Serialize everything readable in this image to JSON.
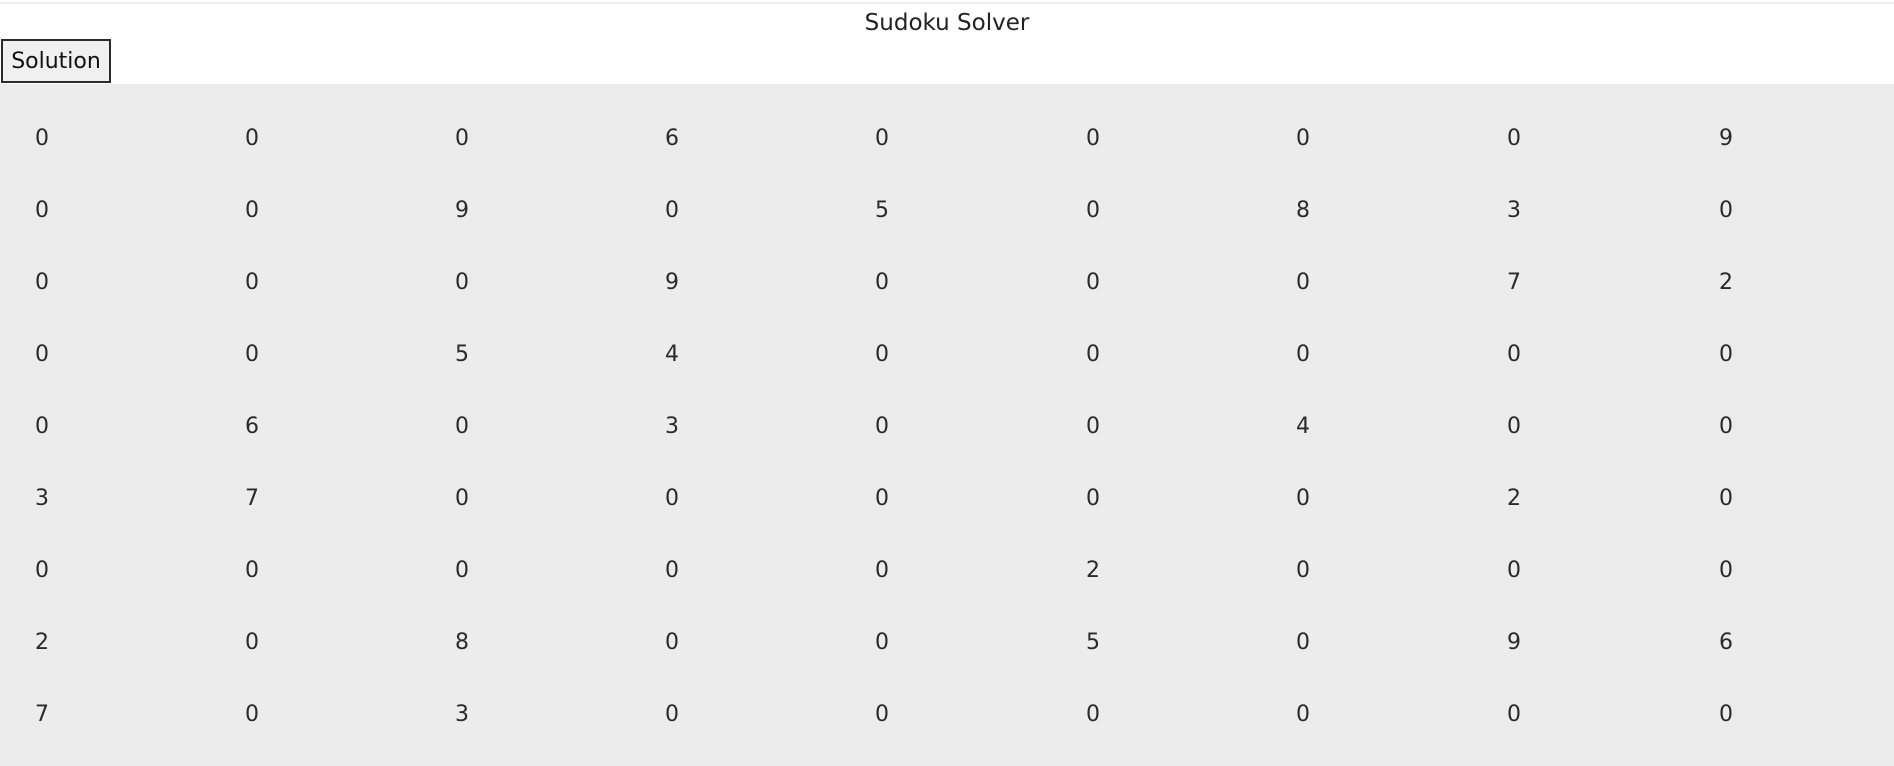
{
  "app": {
    "title": "Sudoku Solver"
  },
  "toolbar": {
    "solution_label": "Solution"
  },
  "board": {
    "rows": [
      [
        "0",
        "0",
        "0",
        "6",
        "0",
        "0",
        "0",
        "0",
        "9"
      ],
      [
        "0",
        "0",
        "9",
        "0",
        "5",
        "0",
        "8",
        "3",
        "0"
      ],
      [
        "0",
        "0",
        "0",
        "9",
        "0",
        "0",
        "0",
        "7",
        "2"
      ],
      [
        "0",
        "0",
        "5",
        "4",
        "0",
        "0",
        "0",
        "0",
        "0"
      ],
      [
        "0",
        "6",
        "0",
        "3",
        "0",
        "0",
        "4",
        "0",
        "0"
      ],
      [
        "3",
        "7",
        "0",
        "0",
        "0",
        "0",
        "0",
        "2",
        "0"
      ],
      [
        "0",
        "0",
        "0",
        "0",
        "0",
        "2",
        "0",
        "0",
        "0"
      ],
      [
        "2",
        "0",
        "8",
        "0",
        "0",
        "5",
        "0",
        "9",
        "6"
      ],
      [
        "7",
        "0",
        "3",
        "0",
        "0",
        "0",
        "0",
        "0",
        "0"
      ]
    ]
  }
}
